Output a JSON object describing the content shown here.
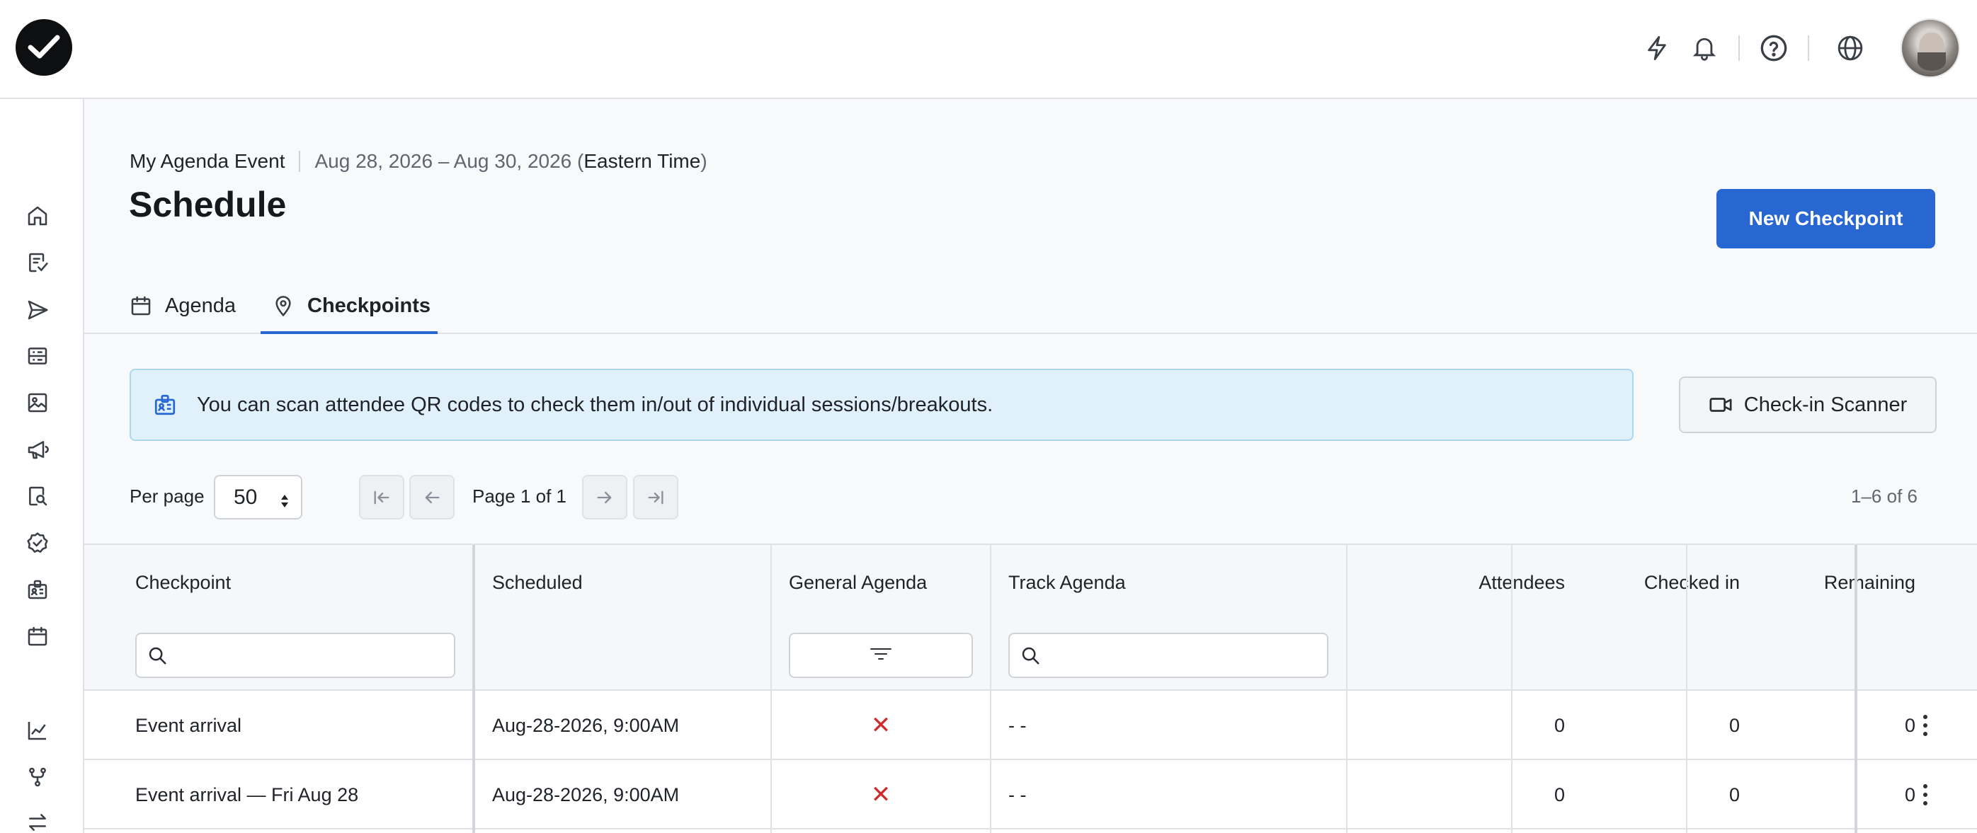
{
  "header": {
    "event_name": "My Agenda Event",
    "dates": "Aug 28, 2026 – Aug 30, 2026 (",
    "timezone": "Eastern Time",
    "timezone_close": ")",
    "page_title": "Schedule",
    "new_button": "New Checkpoint"
  },
  "tabs": [
    {
      "label": "Agenda",
      "icon": "calendar-icon"
    },
    {
      "label": "Checkpoints",
      "icon": "map-pin-icon",
      "active": true
    }
  ],
  "banner": {
    "text": "You can scan attendee QR codes to check them in/out of individual sessions/breakouts.",
    "icon": "id-badge-icon"
  },
  "scanner_button": "Check-in Scanner",
  "pagination": {
    "per_page_label": "Per page",
    "per_page_value": "50",
    "page_label": "Page 1 of 1",
    "range_label": "1–6 of 6"
  },
  "table": {
    "columns": [
      "Checkpoint",
      "Scheduled",
      "General Agenda",
      "Track Agenda",
      "Attendees",
      "Checked in",
      "Remaining"
    ],
    "rows": [
      {
        "checkpoint": "Event arrival",
        "scheduled": "Aug-28-2026, 9:00AM",
        "general_agenda": "✕",
        "track_agenda": "- -",
        "attendees": "0",
        "checked_in": "0",
        "remaining": "0"
      },
      {
        "checkpoint": "Event arrival — Fri Aug 28",
        "scheduled": "Aug-28-2026, 9:00AM",
        "general_agenda": "✕",
        "track_agenda": "- -",
        "attendees": "0",
        "checked_in": "0",
        "remaining": "0"
      }
    ]
  },
  "colors": {
    "primary": "#2866d1",
    "banner_bg": "#e1f1fb",
    "x_mark": "#d02b2b"
  },
  "icons": {
    "topbar": [
      "bolt-icon",
      "bell-icon",
      "help-icon",
      "globe-icon"
    ],
    "sidebar": [
      "home-icon",
      "checklist-icon",
      "send-icon",
      "list-icon",
      "image-icon",
      "megaphone-icon",
      "badge-search-icon",
      "check-circle-icon",
      "id-badge-icon",
      "calendar-icon",
      "chart-icon",
      "branch-icon",
      "swap-icon"
    ]
  }
}
